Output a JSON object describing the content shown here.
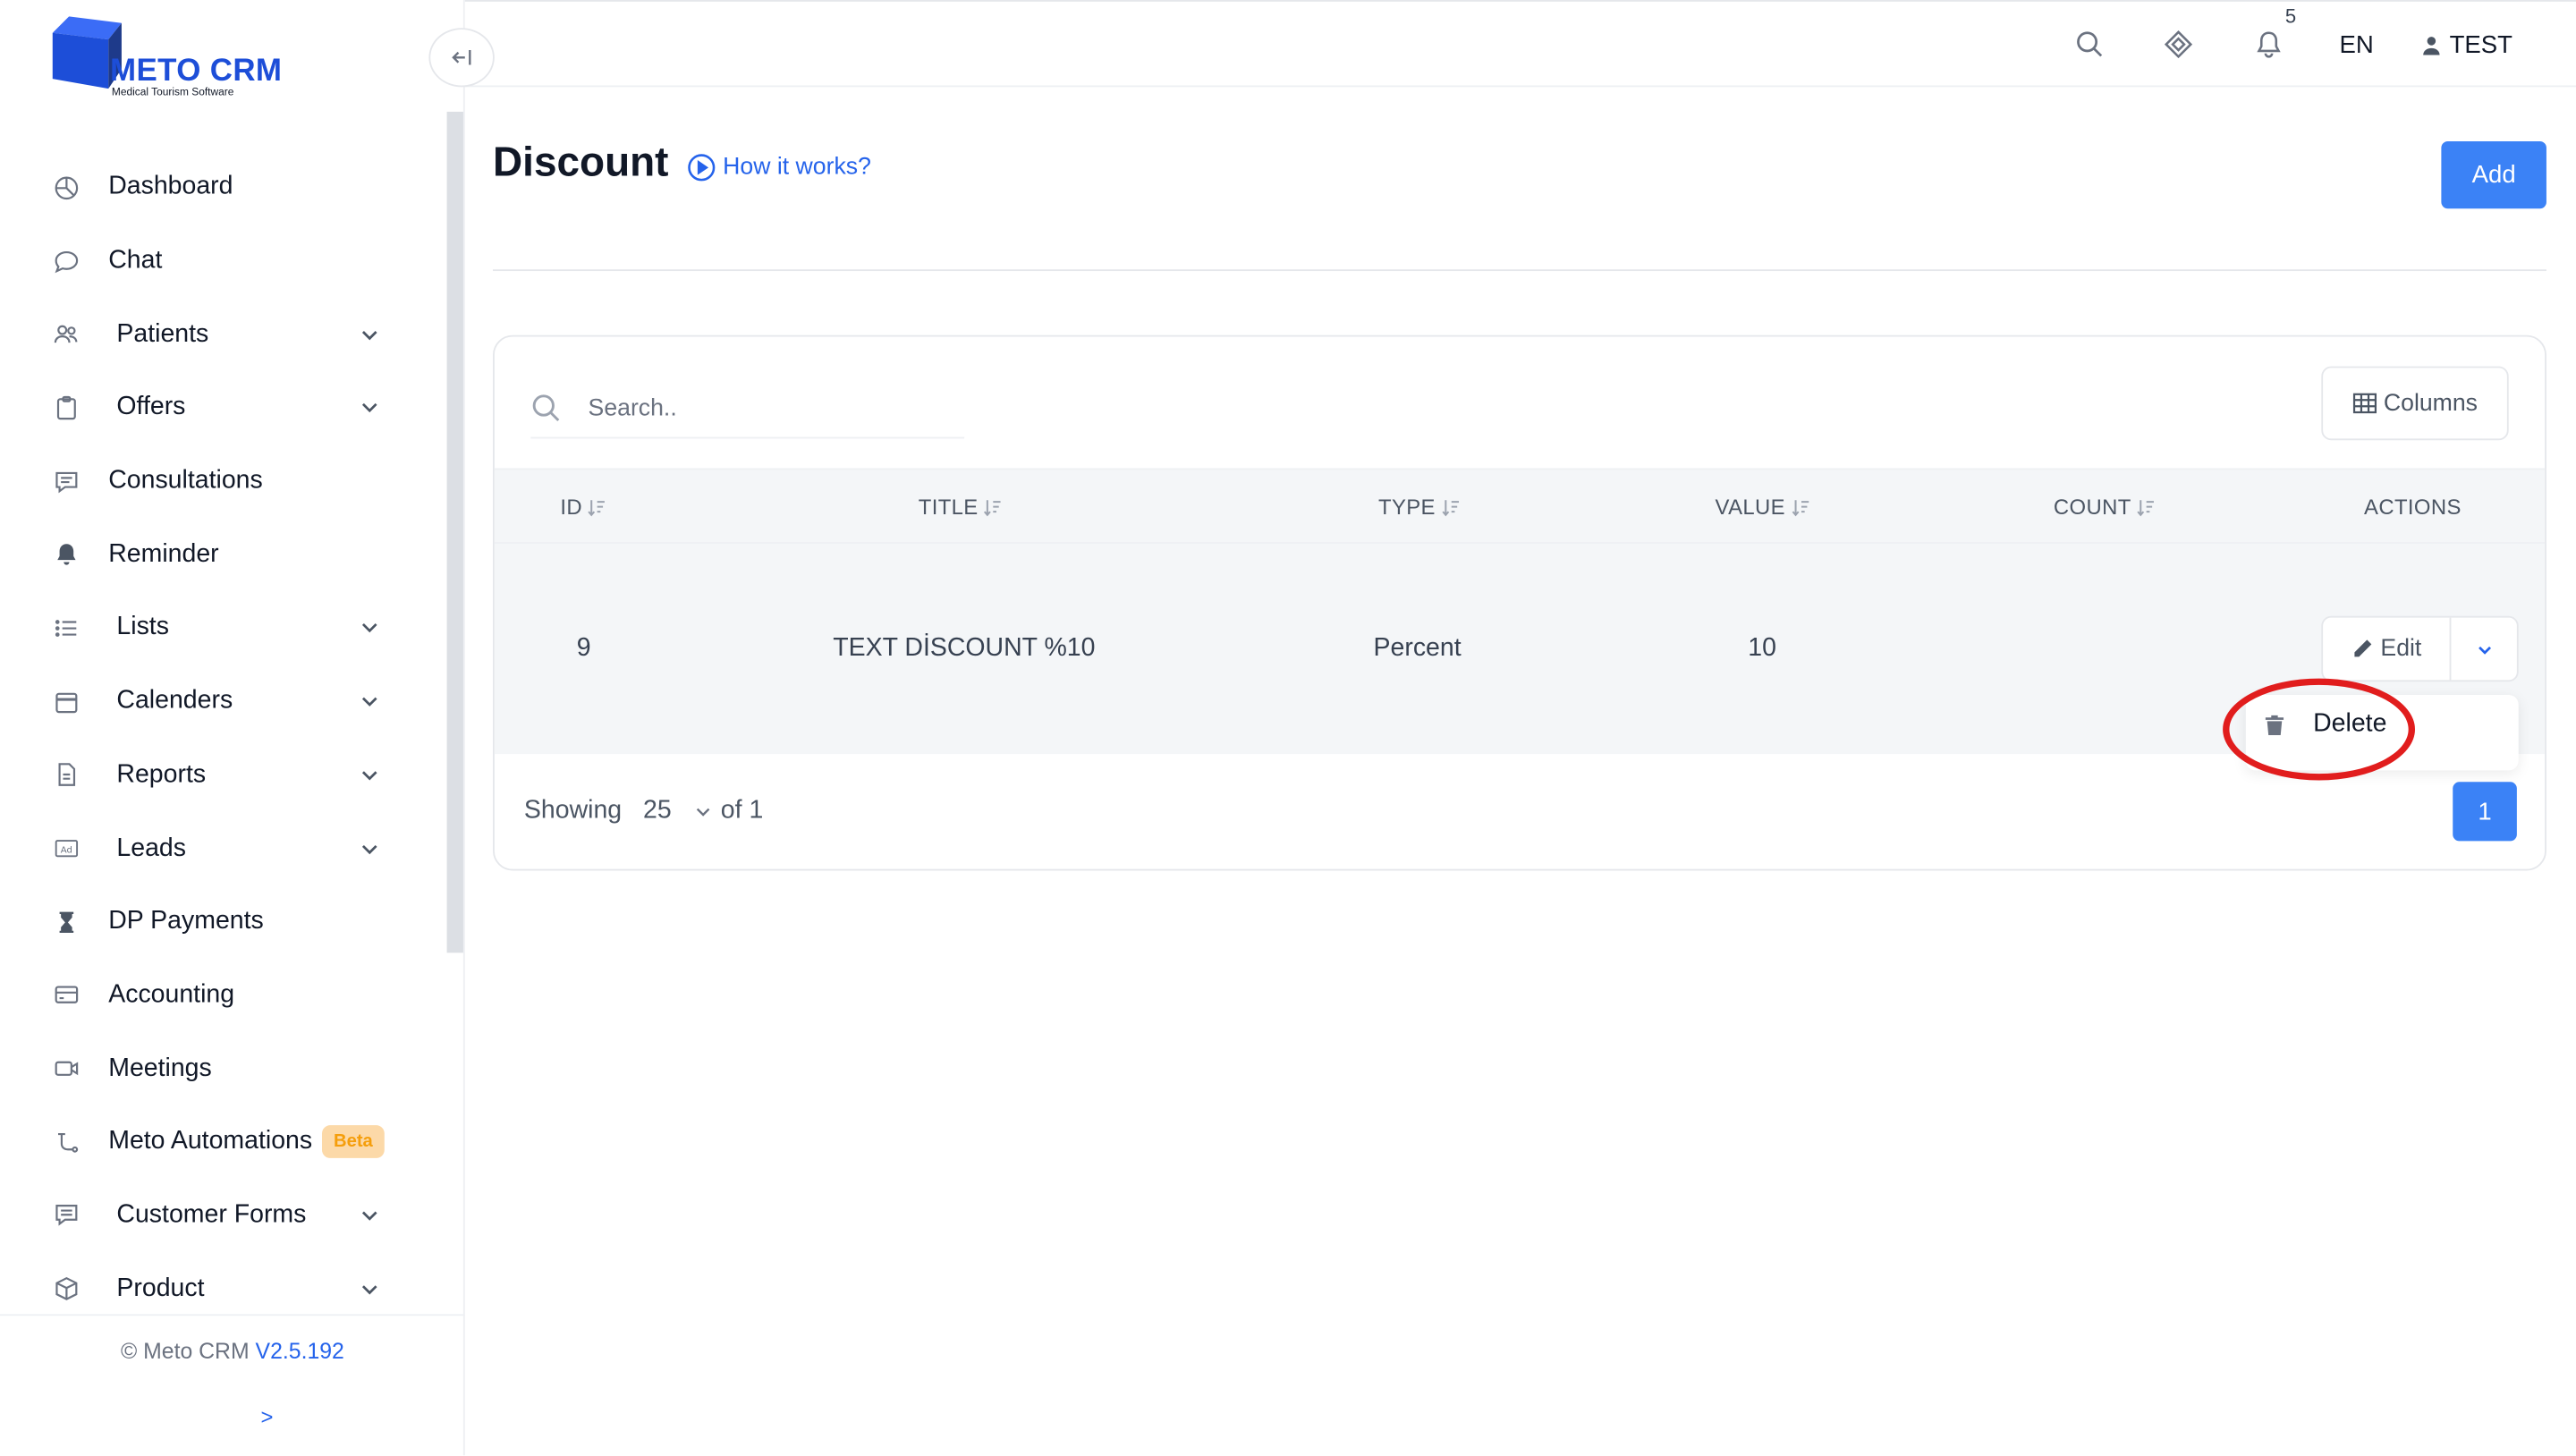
{
  "brand": {
    "name": "METO CRM",
    "tagline": "Medical Tourism Software",
    "color": "#1d4ed8"
  },
  "sidebar": {
    "collapse_icon": "collapse-left-icon",
    "items": [
      {
        "label": "Dashboard",
        "icon": "dashboard-icon",
        "submenu": false
      },
      {
        "label": "Chat",
        "icon": "chat-icon",
        "submenu": false
      },
      {
        "label": "Patients",
        "icon": "users-icon",
        "submenu": true
      },
      {
        "label": "Offers",
        "icon": "clipboard-icon",
        "submenu": true
      },
      {
        "label": "Consultations",
        "icon": "consultation-icon",
        "submenu": false
      },
      {
        "label": "Reminder",
        "icon": "bell-icon",
        "submenu": false
      },
      {
        "label": "Lists",
        "icon": "list-icon",
        "submenu": true
      },
      {
        "label": "Calenders",
        "icon": "calendar-icon",
        "submenu": true
      },
      {
        "label": "Reports",
        "icon": "report-icon",
        "submenu": true
      },
      {
        "label": "Leads",
        "icon": "ad-icon",
        "submenu": true
      },
      {
        "label": "DP Payments",
        "icon": "hourglass-icon",
        "submenu": false
      },
      {
        "label": "Accounting",
        "icon": "credit-card-icon",
        "submenu": false
      },
      {
        "label": "Meetings",
        "icon": "video-icon",
        "submenu": false
      },
      {
        "label": "Meto Automations",
        "icon": "automation-icon",
        "submenu": false,
        "badge": "Beta"
      },
      {
        "label": "Customer Forms",
        "icon": "form-icon",
        "submenu": true
      },
      {
        "label": "Product",
        "icon": "box-icon",
        "submenu": true
      }
    ],
    "footer": {
      "copyright": "© Meto CRM",
      "version": "V2.5.192",
      "expand_label": ">"
    }
  },
  "header": {
    "notification_count": "5",
    "language": "EN",
    "user": "TEST"
  },
  "page": {
    "title": "Discount",
    "how_it_works": "How it works?",
    "add_label": "Add"
  },
  "table": {
    "search_placeholder": "Search..",
    "columns_label": "Columns",
    "headers": [
      "ID",
      "TITLE",
      "TYPE",
      "VALUE",
      "COUNT",
      "ACTIONS"
    ],
    "rows": [
      {
        "id": "9",
        "title": "TEXT DİSCOUNT %10",
        "type": "Percent",
        "value": "10",
        "count": ""
      }
    ],
    "row_actions": {
      "edit_label": "Edit",
      "delete_label": "Delete"
    },
    "footer": {
      "showing_label": "Showing",
      "page_size": "25",
      "of_label": "of 1",
      "current_page": "1"
    }
  },
  "colors": {
    "accent": "#3b82f6",
    "highlight_ring": "#e11d1d",
    "beta_bg": "#fcd9a8",
    "beta_text": "#f59e0b"
  }
}
